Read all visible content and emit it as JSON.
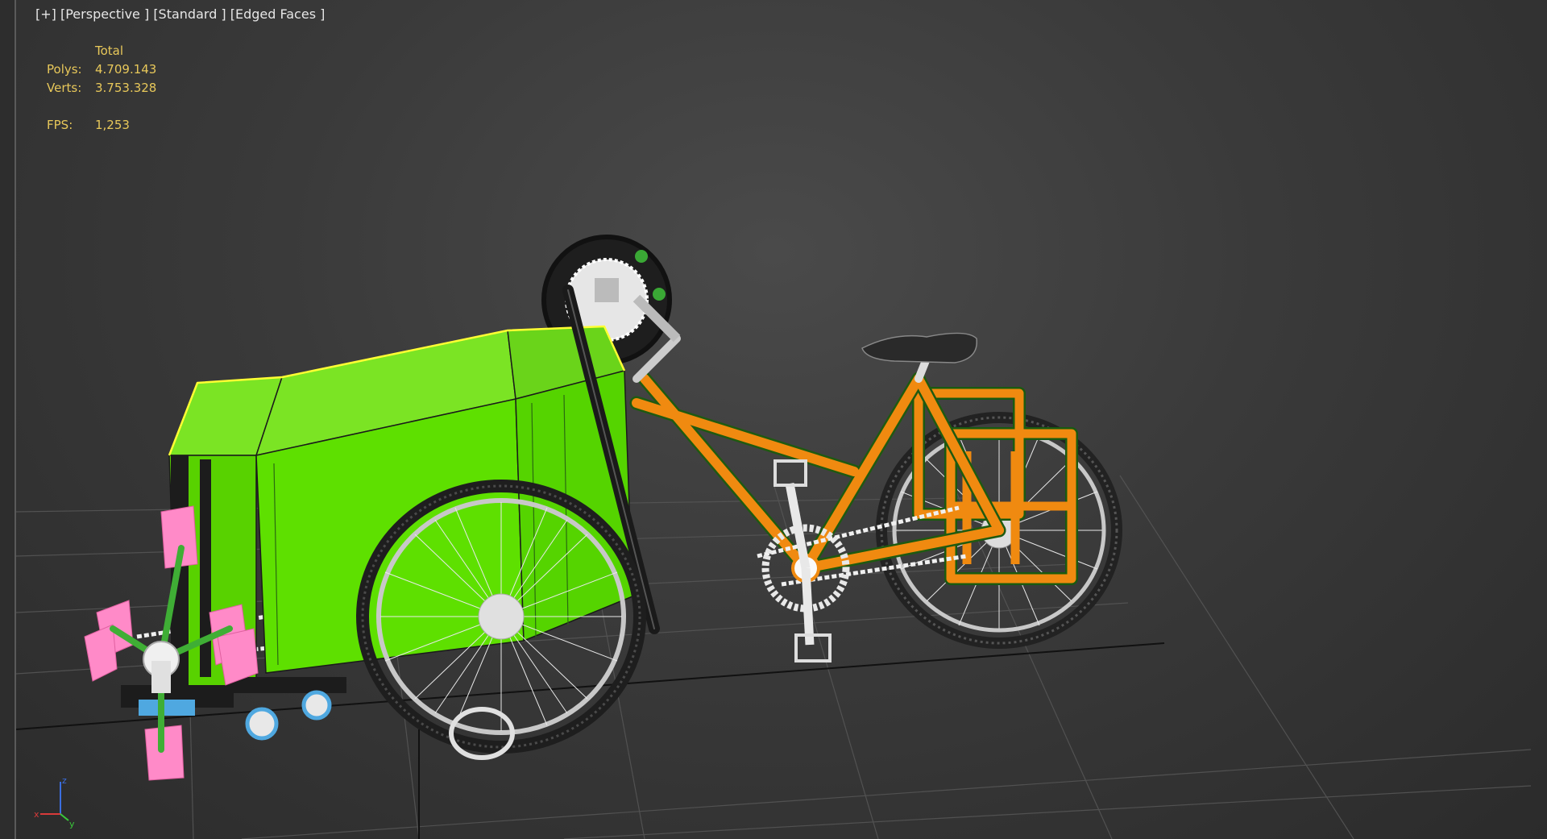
{
  "viewport": {
    "label_plus": "[+]",
    "label_view": "[Perspective ]",
    "label_shading": "[Standard ]",
    "label_mode": "[Edged Faces ]"
  },
  "stats": {
    "header": "Total",
    "polys_label": "Polys:",
    "polys_value": "4.709.143",
    "verts_label": "Verts:",
    "verts_value": "3.753.328",
    "fps_label": "FPS:",
    "fps_value": "1,253"
  },
  "gizmo": {
    "z_label": "z",
    "x_label": "x",
    "y_label": "y"
  },
  "colors": {
    "background": "#3a3a3a",
    "stats_text": "#e8c85a",
    "cargo_box": "#5ee000",
    "frame": "#ee8a12",
    "paddle": "#ff8ac8",
    "caster": "#4fa8e0"
  }
}
